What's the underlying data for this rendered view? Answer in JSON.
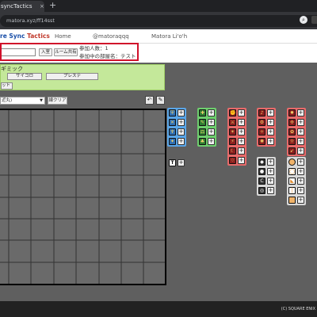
{
  "browser": {
    "tab_title": "syncTactics",
    "tab_close": "×",
    "new_tab": "+",
    "url": "matora.xyz/ff14sst"
  },
  "site": {
    "brand_part1": "re Sync ",
    "brand_part2": "Tactics",
    "nav": [
      "Home",
      "@matoraqqq",
      "Matora Li'o'h"
    ]
  },
  "room": {
    "enter_label": "入室",
    "share_label": "ルーム共有",
    "participants": "参加人数：1",
    "room_name": "参加中の部屋名：テスト"
  },
  "panel": {
    "title": "ギミック",
    "dice_label": "サイコロ",
    "preset_label": "プレステ",
    "left_label": "ット"
  },
  "toolbar": {
    "select_value": "近丸)",
    "clear_label": "線クリア"
  },
  "footer": {
    "copyright": "(C) SQUARE ENIX"
  },
  "colors": {
    "tank_blue": "#5aa6e8",
    "healer_green": "#6ecf6e",
    "dps_red": "#e86a6a",
    "marker_gray": "#d8d8d8",
    "waymark_orange": "#f0b36a",
    "highlight_red": "#d0112b",
    "panel_green": "#c4e89a"
  }
}
